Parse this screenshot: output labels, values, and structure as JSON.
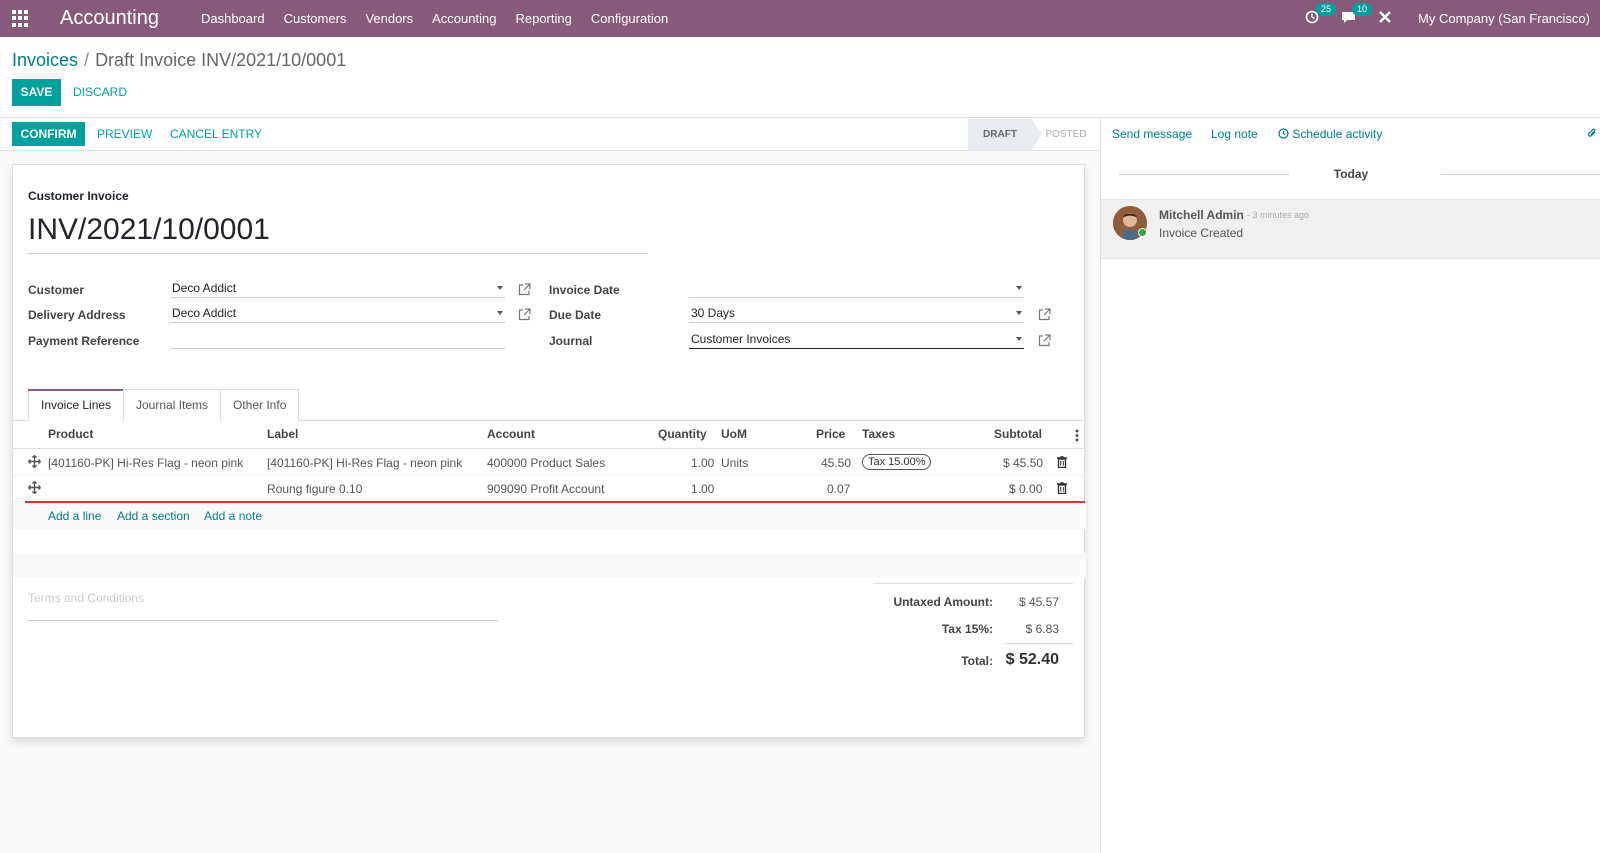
{
  "navbar": {
    "app_name": "Accounting",
    "menu": [
      "Dashboard",
      "Customers",
      "Vendors",
      "Accounting",
      "Reporting",
      "Configuration"
    ],
    "activity_count": "25",
    "message_count": "10",
    "company": "My Company (San Francisco)",
    "bg_color": "#875a7b"
  },
  "breadcrumb": {
    "parent": "Invoices",
    "separator": "/",
    "current": "Draft Invoice INV/2021/10/0001"
  },
  "actions": {
    "save": "SAVE",
    "discard": "DISCARD"
  },
  "statusbar": {
    "confirm": "CONFIRM",
    "preview": "PREVIEW",
    "cancel_entry": "CANCEL ENTRY",
    "stage_draft": "DRAFT",
    "stage_posted": "POSTED"
  },
  "form": {
    "doc_type": "Customer Invoice",
    "doc_name": "INV/2021/10/0001",
    "customer_label": "Customer",
    "customer_value": "Deco Addict",
    "delivery_label": "Delivery Address",
    "delivery_value": "Deco Addict",
    "payref_label": "Payment Reference",
    "payref_value": "",
    "invoice_date_label": "Invoice Date",
    "invoice_date_value": "",
    "due_date_label": "Due Date",
    "due_date_value": "30 Days",
    "journal_label": "Journal",
    "journal_value": "Customer Invoices"
  },
  "tabs": [
    "Invoice Lines",
    "Journal Items",
    "Other Info"
  ],
  "table": {
    "headers": {
      "product": "Product",
      "label": "Label",
      "account": "Account",
      "quantity": "Quantity",
      "uom": "UoM",
      "price": "Price",
      "taxes": "Taxes",
      "subtotal": "Subtotal"
    },
    "rows": [
      {
        "product": "[401160-PK] Hi-Res Flag - neon pink",
        "label": "[401160-PK] Hi-Res Flag - neon pink",
        "account": "400000 Product Sales",
        "quantity": "1.00",
        "uom": "Units",
        "price": "45.50",
        "tax": "Tax 15.00%",
        "subtotal": "$ 45.50"
      },
      {
        "product": "",
        "label": "Roung figure 0.10",
        "account": "909090 Profit Account",
        "quantity": "1.00",
        "uom": "",
        "price": "0.07",
        "tax": "",
        "subtotal": "$ 0.00"
      }
    ],
    "add_line": "Add a line",
    "add_section": "Add a section",
    "add_note": "Add a note"
  },
  "terms_placeholder": "Terms and Conditions",
  "totals": {
    "untaxed_label": "Untaxed Amount:",
    "untaxed_value": "$ 45.57",
    "tax_label": "Tax 15%:",
    "tax_value": "$ 6.83",
    "total_label": "Total:",
    "total_value": "$ 52.40"
  },
  "chatter": {
    "send_message": "Send message",
    "log_note": "Log note",
    "schedule_activity": "Schedule activity",
    "date_separator": "Today",
    "message": {
      "author": "Mitchell Admin",
      "time": "- 3 minutes ago",
      "body": "Invoice Created"
    }
  }
}
